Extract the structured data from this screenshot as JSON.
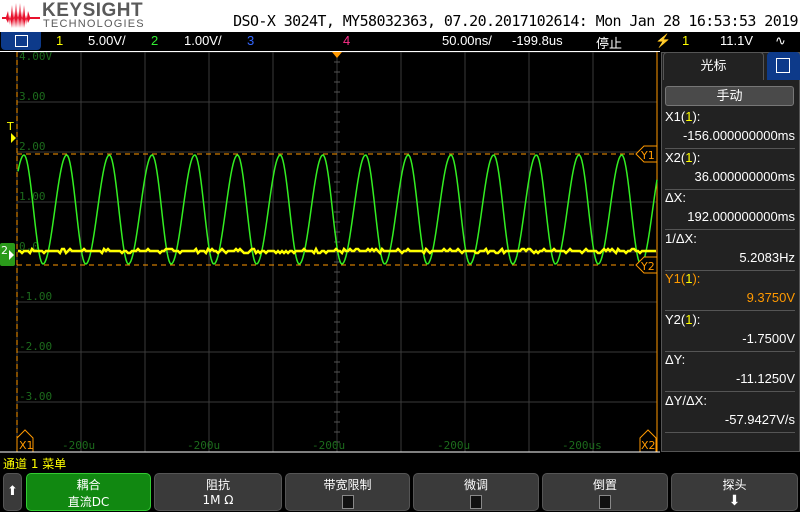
{
  "header": {
    "brand": "KEYSIGHT",
    "brand_sub": "TECHNOLOGIES",
    "device_info": "DSO-X 3024T, MY58032363, 07.20.2017102614: Mon Jan 28 16:53:53 2019"
  },
  "status_bar": {
    "ch1": "1",
    "ch1_scale": "5.00V/",
    "ch2": "2",
    "ch2_scale": "1.00V/",
    "ch3": "3",
    "ch4": "4",
    "timebase": "50.00ns/",
    "delay": "-199.8us",
    "run_state": "停止",
    "trigger_source": "1",
    "trigger_level": "11.1V"
  },
  "colors": {
    "ch1": "#ffff00",
    "ch2": "#33ee22",
    "ch3": "#3366ff",
    "ch4": "#ff2f8a",
    "cursor": "#ff9900"
  },
  "graticule": {
    "y_labels": [
      "4.00V",
      "3.00",
      "2.00",
      "1.00",
      "0.0",
      "-1.00",
      "-2.00",
      "-3.00"
    ],
    "x_labels": [
      "-200u",
      "-200u",
      "-200u",
      "-200u",
      "-200us"
    ],
    "markers": {
      "trigger": "T",
      "ch2_ground": "2",
      "x1": "X1",
      "x2": "X2",
      "y1": "Y1",
      "y2": "Y2"
    }
  },
  "cursors_panel": {
    "title": "光标",
    "mode": "手动",
    "items": [
      {
        "label": "X1(",
        "src": "1",
        "end": "):",
        "value": "-156.000000000ms"
      },
      {
        "label": "X2(",
        "src": "1",
        "end": "):",
        "value": "36.000000000ms"
      },
      {
        "label": "ΔX:",
        "src": "",
        "end": "",
        "value": "192.000000000ms"
      },
      {
        "label": "1/ΔX:",
        "src": "",
        "end": "",
        "value": "5.2083Hz"
      },
      {
        "label": "Y1(",
        "src": "1",
        "end": "):",
        "value": "9.3750V"
      },
      {
        "label": "Y2(",
        "src": "1",
        "end": "):",
        "value": "-1.7500V"
      },
      {
        "label": "ΔY:",
        "src": "",
        "end": "",
        "value": "-11.1250V"
      },
      {
        "label": "ΔY/ΔX:",
        "src": "",
        "end": "",
        "value": "-57.9427V/s"
      }
    ]
  },
  "softkeys": {
    "menu_title": "通道 1 菜单",
    "keys": [
      {
        "label": "耦合",
        "value": "直流DC"
      },
      {
        "label": "阻抗",
        "value": "1M Ω"
      },
      {
        "label": "带宽限制",
        "checked": false
      },
      {
        "label": "微调",
        "checked": false
      },
      {
        "label": "倒置",
        "checked": false
      },
      {
        "label": "探头"
      }
    ]
  }
}
